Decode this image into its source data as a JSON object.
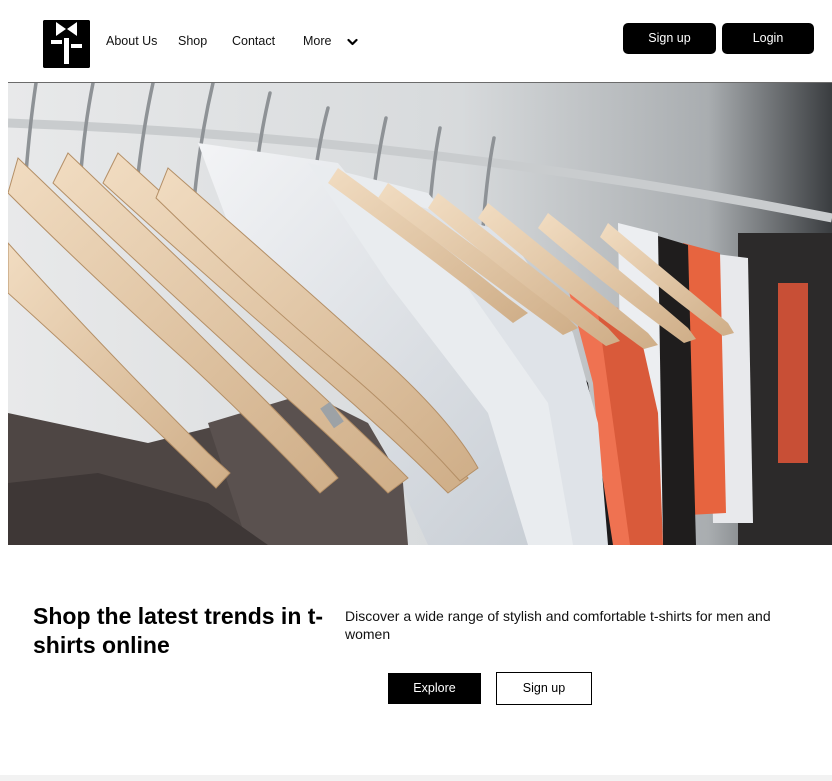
{
  "header": {
    "nav": {
      "about": "About Us",
      "shop": "Shop",
      "contact": "Contact",
      "more": "More"
    },
    "signup_label": "Sign up",
    "login_label": "Login"
  },
  "hero": {
    "image": "clothing-rack-photo"
  },
  "main": {
    "headline": "Shop the latest trends in t-shirts online",
    "description": "Discover a wide range of stylish and comfortable t-shirts for men and women",
    "explore_label": "Explore",
    "signup_label": "Sign up"
  },
  "colors": {
    "primary": "#000000",
    "background": "#ffffff"
  }
}
